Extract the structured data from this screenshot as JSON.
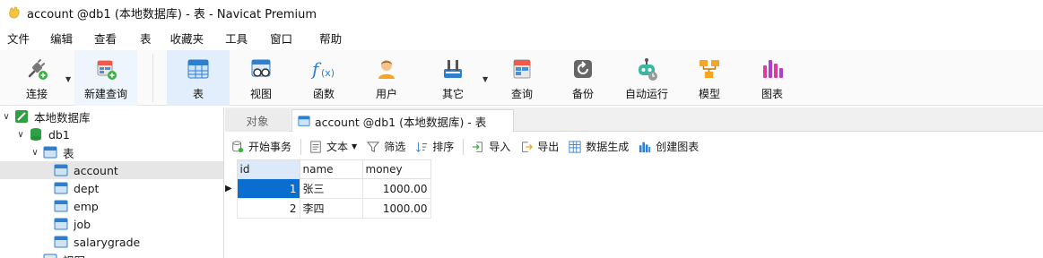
{
  "window": {
    "title": "account @db1 (本地数据库) - 表 - Navicat Premium"
  },
  "menu": [
    "文件",
    "编辑",
    "查看",
    "表",
    "收藏夹",
    "工具",
    "窗口",
    "帮助"
  ],
  "toolbar": {
    "connect": "连接",
    "new_query": "新建查询",
    "table": "表",
    "view": "视图",
    "function": "函数",
    "user": "用户",
    "other": "其它",
    "query": "查询",
    "backup": "备份",
    "automation": "自动运行",
    "model": "模型",
    "chart": "图表"
  },
  "tree": {
    "root": "本地数据库",
    "db": "db1",
    "tables_group": "表",
    "tables": [
      "account",
      "dept",
      "emp",
      "job",
      "salarygrade"
    ],
    "views_group": "视图"
  },
  "tabs": {
    "objects": "对象",
    "active": "account @db1 (本地数据库) - 表"
  },
  "data_toolbar": {
    "begin_transaction": "开始事务",
    "text": "文本",
    "filter": "筛选",
    "sort": "排序",
    "import": "导入",
    "export": "导出",
    "data_generation": "数据生成",
    "create_chart": "创建图表"
  },
  "grid": {
    "columns": [
      "id",
      "name",
      "money"
    ],
    "rows": [
      [
        "1",
        "张三",
        "1000.00"
      ],
      [
        "2",
        "李四",
        "1000.00"
      ]
    ]
  },
  "colors": {
    "accent": "#0a6ed1",
    "active_tab_bg": "#e2eefb"
  }
}
